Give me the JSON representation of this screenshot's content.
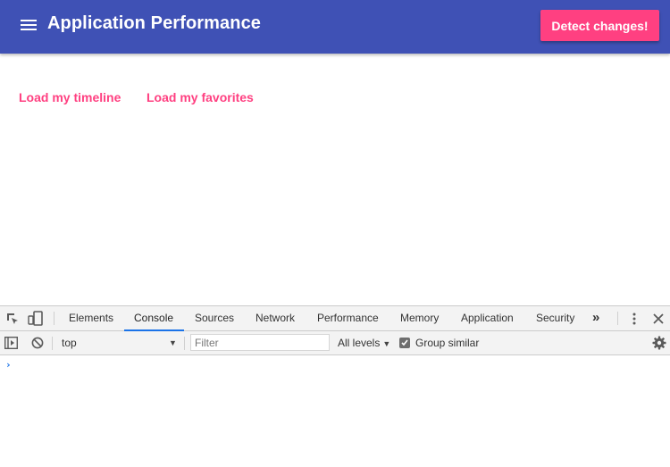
{
  "app": {
    "title": "Application Performance",
    "detect_button_label": "Detect changes!",
    "links": [
      "Load my timeline",
      "Load my favorites"
    ],
    "colors": {
      "toolbar": "#3f51b5",
      "accent": "#ff4081"
    }
  },
  "devtools": {
    "tabs": [
      "Elements",
      "Console",
      "Sources",
      "Network",
      "Performance",
      "Memory",
      "Application",
      "Security"
    ],
    "active_tab": "Console",
    "more_tabs_label": "»",
    "context": "top",
    "filter_placeholder": "Filter",
    "levels_label": "All levels",
    "group_similar_label": "Group similar",
    "group_similar_checked": true,
    "prompt": "›"
  },
  "icons": {
    "menu": "hamburger-menu-icon",
    "inspect": "inspect-element-icon",
    "device": "device-toolbar-icon",
    "more_tabs": "more-tabs-icon",
    "kebab": "kebab-menu-icon",
    "close": "close-icon",
    "sidebar": "show-sidebar-icon",
    "clear": "clear-console-icon",
    "settings": "gear-icon"
  }
}
